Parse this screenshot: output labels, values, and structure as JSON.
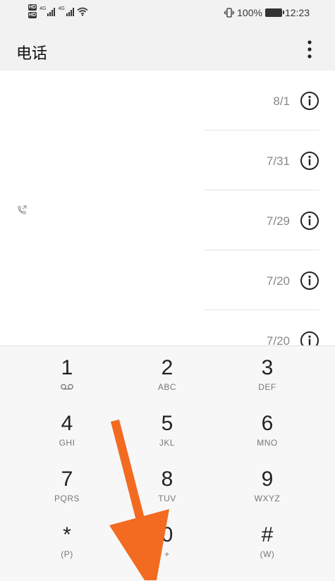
{
  "status_bar": {
    "hd_badges": [
      "HD",
      "HD"
    ],
    "signal_labels": [
      "4G",
      "4G"
    ],
    "battery_percent": "100%",
    "time": "12:23",
    "icons": [
      "vibrate-icon",
      "wifi-icon",
      "battery-charging-icon"
    ]
  },
  "app_bar": {
    "title": "电话",
    "more_icon": "more-vertical-icon"
  },
  "call_log": {
    "entries": [
      {
        "date": "8/1"
      },
      {
        "date": "7/31"
      },
      {
        "date": "7/29"
      },
      {
        "date": "7/20"
      },
      {
        "date": "7/20"
      }
    ],
    "icons": [
      "info-icon",
      "call-outgoing-icon"
    ]
  },
  "dialpad": {
    "keys": [
      {
        "digit": "1",
        "letters": ""
      },
      {
        "digit": "2",
        "letters": "ABC"
      },
      {
        "digit": "3",
        "letters": "DEF"
      },
      {
        "digit": "4",
        "letters": "GHI"
      },
      {
        "digit": "5",
        "letters": "JKL"
      },
      {
        "digit": "6",
        "letters": "MNO"
      },
      {
        "digit": "7",
        "letters": "PQRS"
      },
      {
        "digit": "8",
        "letters": "TUV"
      },
      {
        "digit": "9",
        "letters": "WXYZ"
      },
      {
        "digit": "*",
        "letters": "(P)"
      },
      {
        "digit": "0",
        "letters": "+"
      },
      {
        "digit": "#",
        "letters": "(W)"
      }
    ]
  },
  "annotation": {
    "icon": "down-arrow-icon",
    "color": "#F26B21"
  }
}
